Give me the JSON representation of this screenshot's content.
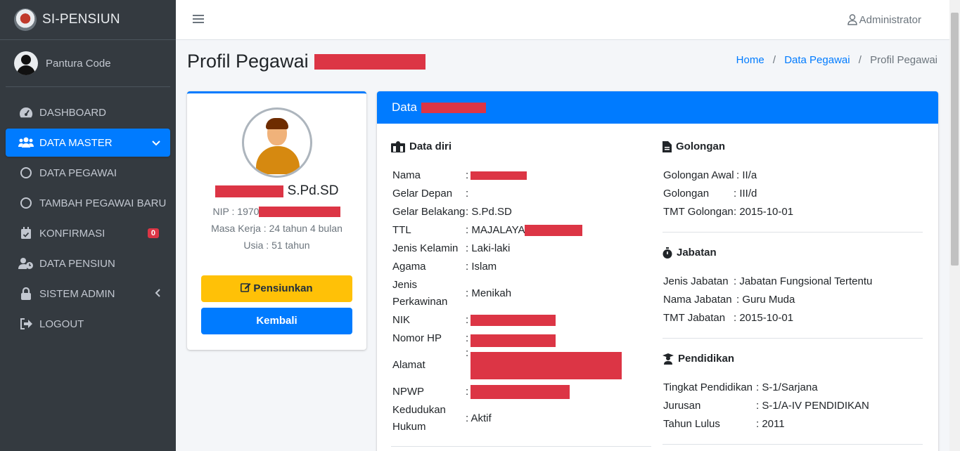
{
  "app": {
    "brand": "SI-PENSIUN",
    "user_name": "Pantura Code"
  },
  "topbar": {
    "admin_label": "Administrator"
  },
  "sidebar": {
    "items": [
      {
        "label": "DASHBOARD",
        "icon": "tachometer-icon"
      },
      {
        "label": "DATA MASTER",
        "icon": "users-icon",
        "active": true
      },
      {
        "label": "DATA PEGAWAI",
        "icon": "circle-icon"
      },
      {
        "label": "TAMBAH PEGAWAI BARU",
        "icon": "circle-icon"
      },
      {
        "label": "KONFIRMASI",
        "icon": "calendar-check-icon",
        "badge": "0"
      },
      {
        "label": "DATA PENSIUN",
        "icon": "user-clock-icon"
      },
      {
        "label": "SISTEM ADMIN",
        "icon": "lock-icon"
      },
      {
        "label": "LOGOUT",
        "icon": "sign-out-icon"
      }
    ]
  },
  "page": {
    "title": "Profil Pegawai"
  },
  "breadcrumb": {
    "home": "Home",
    "data_pegawai": "Data Pegawai",
    "current": "Profil Pegawai"
  },
  "profile": {
    "name_suffix": "S.Pd.SD",
    "nip_label": "NIP : 1970",
    "masa_kerja": "Masa Kerja : 24 tahun 4 bulan",
    "usia": "Usia : 51 tahun",
    "btn_pensiunkan": "Pensiunkan",
    "btn_kembali": "Kembali"
  },
  "data_card": {
    "header": "Data",
    "data_diri": {
      "title": "Data diri",
      "rows": [
        {
          "label": "Nama",
          "value": ": "
        },
        {
          "label": "Gelar Depan",
          "value": ":"
        },
        {
          "label": "Gelar Belakang",
          "value": ": S.Pd.SD"
        },
        {
          "label": "TTL",
          "value": ": MAJALAYA"
        },
        {
          "label": "Jenis Kelamin",
          "value": ": Laki-laki"
        },
        {
          "label": "Agama",
          "value": ": Islam"
        },
        {
          "label": "Jenis Perkawinan",
          "value": ": Menikah"
        },
        {
          "label": "NIK",
          "value": ":"
        },
        {
          "label": "Nomor HP",
          "value": ":"
        },
        {
          "label": "Alamat",
          "value": ":"
        },
        {
          "label": "NPWP",
          "value": ":"
        },
        {
          "label": "Kedudukan Hukum",
          "value": ": Aktif"
        }
      ]
    },
    "golongan": {
      "title": "Golongan",
      "rows": [
        {
          "label": "Golongan Awal",
          "value": ": II/a"
        },
        {
          "label": "Golongan",
          "value": ": III/d"
        },
        {
          "label": "TMT Golongan",
          "value": ": 2015-10-01"
        }
      ]
    },
    "jabatan": {
      "title": "Jabatan",
      "rows": [
        {
          "label": "Jenis Jabatan",
          "value": ": Jabatan Fungsional Tertentu"
        },
        {
          "label": "Nama Jabatan",
          "value": ": Guru Muda"
        },
        {
          "label": "TMT Jabatan",
          "value": ": 2015-10-01"
        }
      ]
    },
    "pendidikan": {
      "title": "Pendidikan",
      "rows": [
        {
          "label": "Tingkat Pendidikan",
          "value": ": S-1/Sarjana"
        },
        {
          "label": "Jurusan",
          "value": ": S-1/A-IV PENDIDIKAN"
        },
        {
          "label": "Tahun Lulus",
          "value": ": 2011"
        }
      ]
    }
  },
  "colors": {
    "primary": "#007bff",
    "warning": "#ffc107",
    "sidebar": "#343a40",
    "redaction": "#dc3545"
  }
}
